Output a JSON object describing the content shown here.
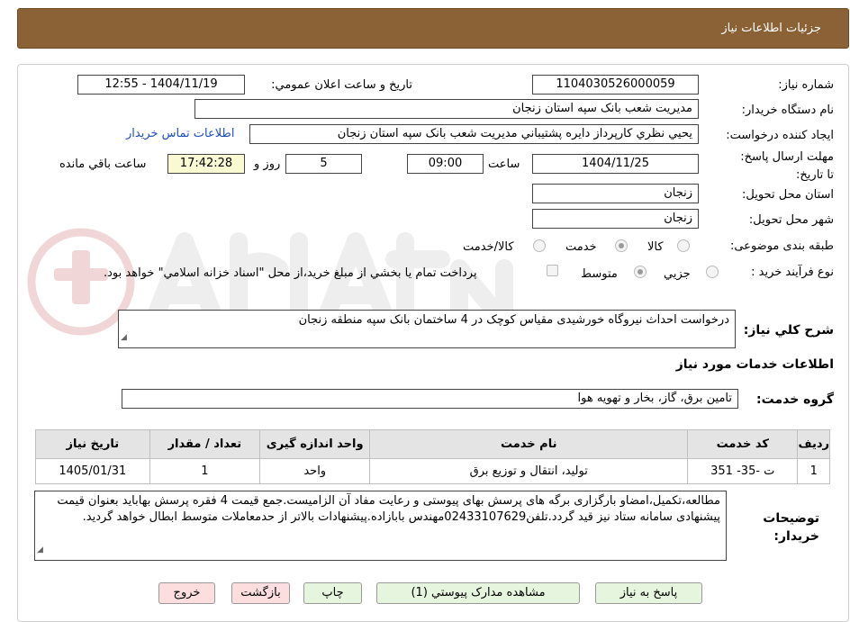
{
  "header": {
    "title": "جزئیات اطلاعات نیاز"
  },
  "form": {
    "need_number_label": "شماره نیاز:",
    "need_number": "1104030526000059",
    "announce_label": "تاریخ و ساعت اعلان عمومي:",
    "announce_value": "1404/11/19 - 12:55",
    "buyer_org_label": "نام دستگاه خريدار:",
    "buyer_org": "مديريت شعب بانک سپه استان زنجان",
    "requester_label": "ايجاد کننده درخواست:",
    "requester": "يحيي نظري کارپرداز دايره پشتيباني  مديريت شعب بانک سپه استان زنجان",
    "contact_link": "اطلاعات تماس خريدار",
    "deadline_label": "مهلت ارسال پاسخ: تا تاريخ:",
    "deadline_date": "1404/11/25",
    "time_label": "ساعت",
    "deadline_time": "09:00",
    "days_value": "5",
    "days_label": "روز و",
    "remaining_time": "17:42:28",
    "remaining_label": "ساعت باقي مانده",
    "province_label": "استان محل تحويل:",
    "province": "زنجان",
    "city_label": "شهر محل تحويل:",
    "city": "زنجان",
    "category_label": "طبقه بندی موضوعی:",
    "category_options": [
      "کالا",
      "خدمت",
      "کالا/خدمت"
    ],
    "category_selected": "خدمت",
    "process_label": "نوع فرآيند خريد :",
    "process_options": [
      "جزيي",
      "متوسط"
    ],
    "process_selected": "متوسط",
    "payment_note": "پرداخت تمام يا بخشي از مبلغ خريد،از محل \"اسناد خزانه اسلامي\" خواهد بود.",
    "summary_label": "شرح کلي نياز:",
    "summary": "درخواست احداث نیروگاه خورشیدی مقیاس کوچک در 4 ساختمان بانک سپه منطقه زنجان",
    "services_heading": "اطلاعات خدمات مورد نياز",
    "service_group_label": "گروه خدمت:",
    "service_group": "تامین برق، گاز، بخار و تهویه هوا"
  },
  "table": {
    "headers": [
      "رديف",
      "کد خدمت",
      "نام خدمت",
      "واحد اندازه گيری",
      "تعداد / مقدار",
      "تاريخ نياز"
    ],
    "rows": [
      [
        "1",
        "ت -35- 351",
        "تولید، انتقال و توزیع برق",
        "واحد",
        "1",
        "1405/01/31"
      ]
    ]
  },
  "buyer_notes_label": "توضيحات خريدار:",
  "buyer_notes": "مطالعه،تکمیل،امضاو بارگزاری برگه های پرسش بهای پیوستی و رعایت مفاد آن الزامیست.جمع قیمت 4 فقره پرسش بهاباید بعنوان قیمت پیشنهادی سامانه ستاد نیز قید گردد.تلفن02433107629مهندس بابازاده.پیشنهادات بالاتر از حدمعاملات متوسط ابطال خواهد گردید.",
  "buttons": {
    "reply": "پاسخ به نياز",
    "attachments": "مشاهده مدارک پيوستي (1)",
    "print": "چاپ",
    "back": "بازگشت",
    "exit": "خروج"
  },
  "colors": {
    "header_bg": "#8b6236",
    "button_green": "#e6f5dd",
    "button_pink": "#fcdede",
    "remaining_bg": "#fafad2",
    "link": "#1e4fb8"
  }
}
